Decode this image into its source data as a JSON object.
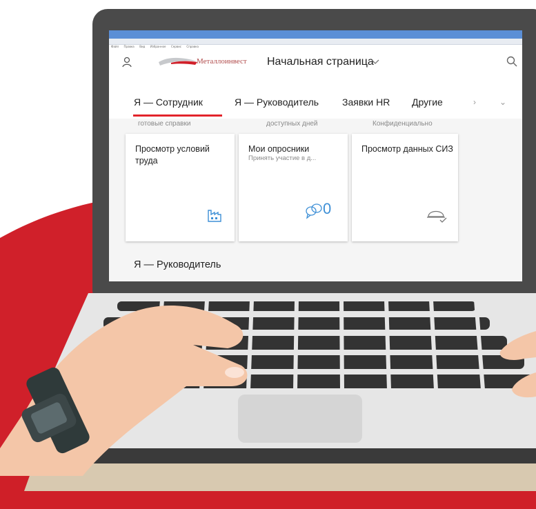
{
  "browser": {
    "menu_items": [
      "Файл",
      "Правка",
      "Вид",
      "Избранное",
      "Сервис",
      "Справка"
    ]
  },
  "header": {
    "logo_text": "Металлоинвест",
    "page_title": "Начальная страница"
  },
  "tabs": [
    {
      "label": "Я — Сотрудник",
      "active": true
    },
    {
      "label": "Я — Руководитель",
      "active": false
    },
    {
      "label": "Заявки HR",
      "active": false
    },
    {
      "label": "Другие",
      "active": false
    }
  ],
  "card_tops": [
    "готовые справки",
    "доступных дней",
    "Конфиденциально"
  ],
  "cards": [
    {
      "title": "Просмотр условий труда",
      "subtitle": "",
      "icon": "factory-icon"
    },
    {
      "title": "Мои опросники",
      "subtitle": "Принять участие в д...",
      "icon": "survey-icon",
      "count": "0"
    },
    {
      "title": "Просмотр данных СИЗ",
      "subtitle": "",
      "icon": "hard-hat-icon"
    }
  ],
  "section": {
    "heading": "Я — Руководитель"
  },
  "colors": {
    "accent_red": "#e2232a",
    "icon_blue": "#3d8fd6",
    "laptop_bezel": "#4a4a4a",
    "skin": "#f4c6a8"
  }
}
